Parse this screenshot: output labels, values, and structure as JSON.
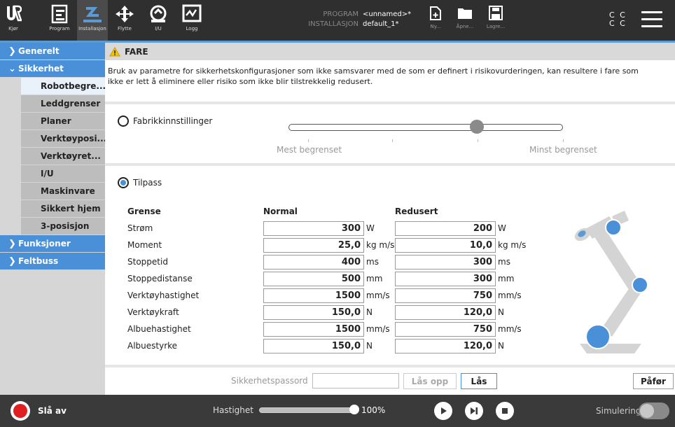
{
  "topbar": {
    "nav": [
      {
        "label": "Kjør",
        "icon": "ur-logo-icon"
      },
      {
        "label": "Program",
        "icon": "program-icon"
      },
      {
        "label": "Installasjon",
        "icon": "installation-icon"
      },
      {
        "label": "Flytte",
        "icon": "move-icon"
      },
      {
        "label": "I/U",
        "icon": "io-icon"
      },
      {
        "label": "Logg",
        "icon": "log-icon"
      }
    ],
    "program_key": "PROGRAM",
    "program_value": "<unnamed>*",
    "installation_key": "INSTALLASJON",
    "installation_value": "default_1*",
    "file_buttons": [
      {
        "label": "Ny...",
        "icon": "new-file-icon"
      },
      {
        "label": "Åpne...",
        "icon": "folder-icon"
      },
      {
        "label": "Lagre...",
        "icon": "save-icon"
      }
    ],
    "cc": "C C"
  },
  "sidebar": {
    "sections": [
      {
        "label": "Generelt",
        "expanded": false
      },
      {
        "label": "Sikkerhet",
        "expanded": true
      },
      {
        "label": "Funksjoner",
        "expanded": false
      },
      {
        "label": "Feltbuss",
        "expanded": false
      }
    ],
    "safety_items": [
      "Robotbegre...",
      "Leddgrenser",
      "Planer",
      "Verktøyposi...",
      "Verktøyret...",
      "I/U",
      "Maskinvare",
      "Sikkert hjem",
      "3-posisjon"
    ],
    "selected": "Robotbegre..."
  },
  "warning": {
    "title": "FARE",
    "line1": "Bruk av parametre for sikkerhetskonfigurasjoner som ikke samsvarer med de som er definert i risikovurderingen, kan resultere i fare som",
    "line2": "ikke er lett å eliminere eller risiko som ikke blir tilstrekkelig redusert."
  },
  "factory": {
    "label": "Fabrikkinnstillinger",
    "selected": false,
    "slider_min_label": "Mest begrenset",
    "slider_max_label": "Minst begrenset",
    "slider_position": 0.67
  },
  "custom": {
    "label": "Tilpass",
    "selected": true,
    "headers": {
      "limit": "Grense",
      "normal": "Normal",
      "reduced": "Redusert"
    },
    "rows": [
      {
        "name": "Strøm",
        "normal": "300",
        "reduced": "200",
        "unit": "W"
      },
      {
        "name": "Moment",
        "normal": "25,0",
        "reduced": "10,0",
        "unit": "kg m/s"
      },
      {
        "name": "Stoppetid",
        "normal": "400",
        "reduced": "300",
        "unit": "ms"
      },
      {
        "name": "Stoppedistanse",
        "normal": "500",
        "reduced": "300",
        "unit": "mm"
      },
      {
        "name": "Verktøyhastighet",
        "normal": "1500",
        "reduced": "750",
        "unit": "mm/s"
      },
      {
        "name": "Verktøykraft",
        "normal": "150,0",
        "reduced": "120,0",
        "unit": "N"
      },
      {
        "name": "Albuehastighet",
        "normal": "1500",
        "reduced": "750",
        "unit": "mm/s"
      },
      {
        "name": "Albuestyrke",
        "normal": "150,0",
        "reduced": "120,0",
        "unit": "N"
      }
    ]
  },
  "bottom": {
    "password_label": "Sikkerhetspassord",
    "password_value": "",
    "unlock": "Lås opp",
    "lock": "Lås",
    "apply": "Påfør"
  },
  "footer": {
    "power_label": "Slå av",
    "speed_label": "Hastighet",
    "speed_value": "100%",
    "speed_fraction": 1.0,
    "simulation_label": "Simulering",
    "simulation_on": false
  }
}
